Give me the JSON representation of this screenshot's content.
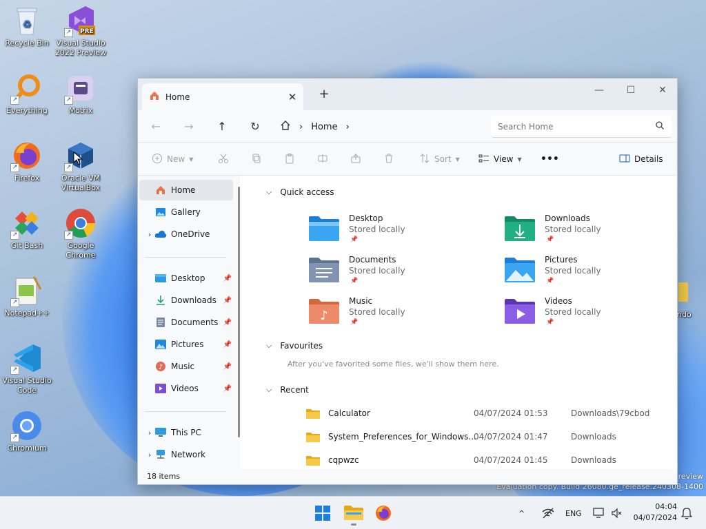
{
  "desktop": {
    "icons": [
      {
        "label": "Recycle Bin",
        "icon": "recycle-bin-icon"
      },
      {
        "label": "Visual Studio 2022 Preview",
        "icon": "visual-studio-icon",
        "badge": "PRE"
      },
      {
        "label": "Everything",
        "icon": "everything-search-icon"
      },
      {
        "label": "Motrix",
        "icon": "motrix-icon"
      },
      {
        "label": "Firefox",
        "icon": "firefox-icon"
      },
      {
        "label": "Oracle VM VirtualBox",
        "icon": "virtualbox-icon"
      },
      {
        "label": "Git Bash",
        "icon": "git-bash-icon"
      },
      {
        "label": "Google Chrome",
        "icon": "chrome-icon"
      },
      {
        "label": "Notepad++",
        "icon": "notepad-plus-plus-icon"
      },
      {
        "label": "Visual Studio Code",
        "icon": "vscode-icon"
      },
      {
        "label": "Chromium",
        "icon": "chromium-icon"
      }
    ],
    "partial_icon_label": "ndo",
    "watermark_line1": "review",
    "watermark_line2": "Evaluation copy. Build 26080.ge_release.240308-1400"
  },
  "window": {
    "tab": {
      "label": "Home",
      "close": "✕"
    },
    "new_tab": "+",
    "controls": {
      "minimize": "—",
      "maximize": "☐",
      "close": "✕"
    },
    "nav": {
      "back": "←",
      "forward": "→",
      "up": "↑",
      "refresh": "↻"
    },
    "breadcrumb": {
      "location": "Home",
      "separator": "›"
    },
    "search": {
      "placeholder": "Search Home"
    },
    "toolbar": {
      "new_label": "New",
      "sort_label": "Sort",
      "view_label": "View",
      "more_label": "•••",
      "details_label": "Details"
    },
    "sidebar": {
      "home": "Home",
      "gallery": "Gallery",
      "onedrive": "OneDrive",
      "pinned": [
        {
          "label": "Desktop",
          "icon": "desktop-folder-icon"
        },
        {
          "label": "Downloads",
          "icon": "downloads-icon"
        },
        {
          "label": "Documents",
          "icon": "documents-icon"
        },
        {
          "label": "Pictures",
          "icon": "pictures-icon"
        },
        {
          "label": "Music",
          "icon": "music-icon"
        },
        {
          "label": "Videos",
          "icon": "videos-icon"
        }
      ],
      "this_pc": "This PC",
      "network": "Network"
    },
    "main": {
      "quick_access_title": "Quick access",
      "quick_access": [
        {
          "name": "Desktop",
          "sub": "Stored locally",
          "icon": "desktop-folder-icon",
          "color": "#1e88e5"
        },
        {
          "name": "Downloads",
          "sub": "Stored locally",
          "icon": "downloads-folder-icon",
          "color": "#1aa37a"
        },
        {
          "name": "Documents",
          "sub": "Stored locally",
          "icon": "documents-folder-icon",
          "color": "#6b7f99"
        },
        {
          "name": "Pictures",
          "sub": "Stored locally",
          "icon": "pictures-folder-icon",
          "color": "#1e88e5"
        },
        {
          "name": "Music",
          "sub": "Stored locally",
          "icon": "music-folder-icon",
          "color": "#e06b5a"
        },
        {
          "name": "Videos",
          "sub": "Stored locally",
          "icon": "videos-folder-icon",
          "color": "#7b4fd6"
        }
      ],
      "favourites_title": "Favourites",
      "favourites_empty": "After you've favorited some files, we'll show them here.",
      "recent_title": "Recent",
      "recent": [
        {
          "name": "Calculator",
          "date": "04/07/2024 01:53",
          "location": "Downloads\\79cbod"
        },
        {
          "name": "System_Preferences_for_Windows...",
          "date": "04/07/2024 01:47",
          "location": "Downloads"
        },
        {
          "name": "cqpwzc",
          "date": "04/07/2024 01:45",
          "location": "Downloads"
        }
      ]
    },
    "status": {
      "items": "18 items"
    }
  },
  "taskbar": {
    "language": "ENG",
    "time": "04:04",
    "date": "04/07/2024",
    "chevron": "^"
  }
}
